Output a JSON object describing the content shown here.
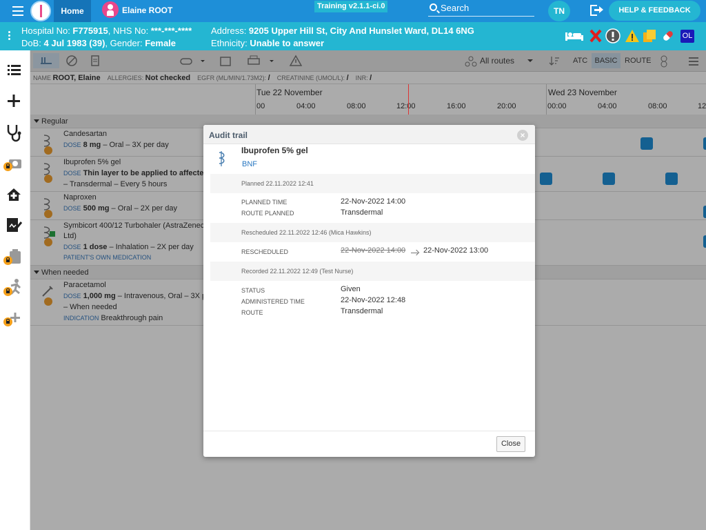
{
  "topbar": {
    "home_label": "Home",
    "patient_name": "Elaine ROOT",
    "training_label": "Training v2.1.1-ci.0",
    "search_label": "Search",
    "user_initials": "TN",
    "help_label": "HELP & FEEDBACK"
  },
  "banner": {
    "hospital_label": "Hospital No: ",
    "hospital_value": "F775915",
    "nhs_label": ", NHS No: ",
    "nhs_value": "***-***-****",
    "dob_label": "DoB: ",
    "dob_value": "4 Jul 1983 (39)",
    "gender_label": ", Gender: ",
    "gender_value": "Female",
    "address_label": "Address: ",
    "address_value": "9205 Upper Hill St, City And Hunslet Ward, DL14 6NG",
    "ethnicity_label": "Ethnicity: ",
    "ethnicity_value": "Unable to answer",
    "ol_badge": "OL"
  },
  "toolbar": {
    "routes_label": "All routes",
    "atc_label": "ATC",
    "basic_label": "BASIC",
    "route_label": "ROUTE"
  },
  "infobar": {
    "name_key": "NAME",
    "name_value": "ROOT, Elaine",
    "allergies_key": "ALLERGIES:",
    "allergies_value": "Not checked",
    "egfr_key": "EGFR (ML/MIN/1.73M2):",
    "egfr_value": "/",
    "creat_key": "CREATININE (UMOL/L):",
    "creat_value": "/",
    "inr_key": "INR:",
    "inr_value": "/"
  },
  "timeline": {
    "day1": "Tue 22 November",
    "day2": "Wed 23 November",
    "hours": [
      "00",
      "04:00",
      "08:00",
      "12:00",
      "16:00",
      "20:00",
      "00:00",
      "04:00",
      "08:00",
      "12"
    ]
  },
  "sections": {
    "regular": "Regular",
    "when_needed": "When needed"
  },
  "meds": [
    {
      "name": "Candesartan",
      "dose_key": "DOSE",
      "dose_bold": "8 mg",
      "dose_rest": " – Oral – 3X per day"
    },
    {
      "name": "Ibuprofen 5% gel",
      "dose_key": "DOSE",
      "dose_bold": "Thin layer to be applied to affecte",
      "line3": "– Transdermal – Every 5 hours"
    },
    {
      "name": "Naproxen",
      "dose_key": "DOSE",
      "dose_bold": "500 mg",
      "dose_rest": " – Oral – 2X per day"
    },
    {
      "name": "Symbicort 400/12 Turbohaler (AstraZenec",
      "name2": "Ltd)",
      "dose_key": "DOSE",
      "dose_bold": "1 dose",
      "dose_rest": " – Inhalation – 2X per day",
      "note": "PATIENT'S OWN MEDICATION"
    },
    {
      "name": "Paracetamol",
      "dose_key": "DOSE",
      "dose_bold": "1,000 mg",
      "dose_rest": " – Intravenous, Oral – 3X p",
      "line3": "– When needed",
      "ind_key": "INDICATION",
      "ind_value": "Breakthrough pain"
    }
  ],
  "modal": {
    "title": "Audit trail",
    "med_name": "Ibuprofen 5% gel",
    "bnf": "BNF",
    "planned_band": "Planned 22.11.2022 12:41",
    "planned_time_key": "PLANNED TIME",
    "planned_time_value": "22-Nov-2022 14:00",
    "route_planned_key": "ROUTE PLANNED",
    "route_planned_value": "Transdermal",
    "rescheduled_band": "Rescheduled 22.11.2022 12:46 (Mica Hawkins)",
    "rescheduled_key": "RESCHEDULED",
    "rescheduled_old": "22-Nov-2022 14:00",
    "rescheduled_new": "22-Nov-2022 13:00",
    "recorded_band": "Recorded 22.11.2022 12:49 (Test Nurse)",
    "status_key": "STATUS",
    "status_value": "Given",
    "admin_time_key": "ADMINISTERED TIME",
    "admin_time_value": "22-Nov-2022 12:48",
    "route_key": "ROUTE",
    "route_value": "Transdermal",
    "close_label": "Close"
  },
  "colors": {
    "topbar": "#1e8fd8",
    "banner": "#24b6d2",
    "accent_pink": "#e8478b",
    "lock": "#f5a01a",
    "dose_square": "#1e8fd8"
  }
}
